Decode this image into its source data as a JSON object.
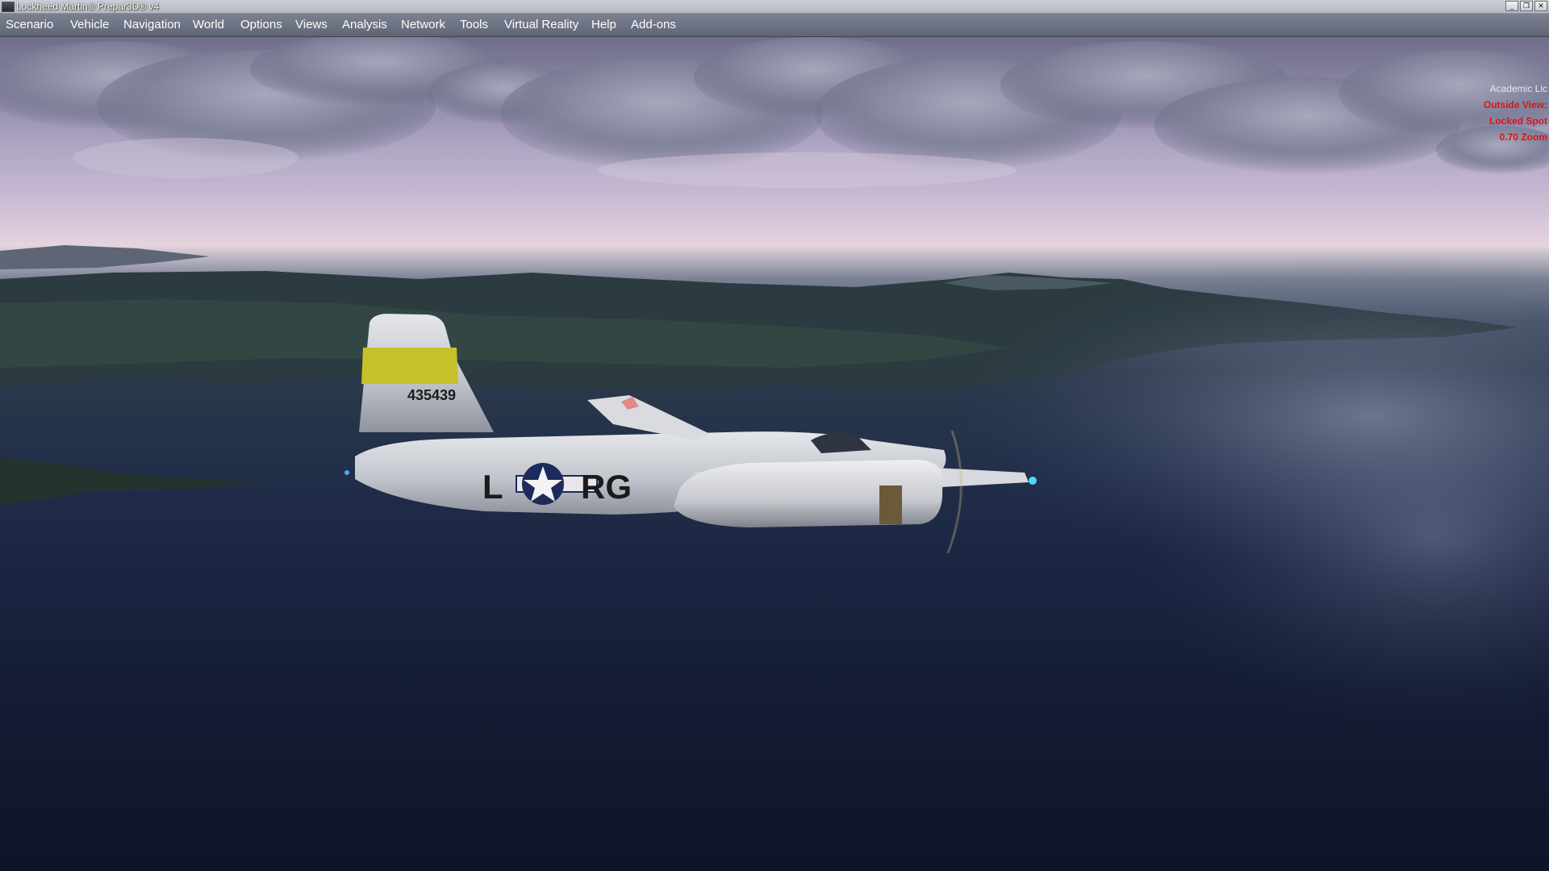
{
  "window": {
    "title": "Lockheed Martin® Prepar3D® v4",
    "controls": {
      "minimize": "_",
      "restore": "❐",
      "close": "✕"
    }
  },
  "menu": [
    {
      "label": "Scenario"
    },
    {
      "label": "Vehicle"
    },
    {
      "label": "Navigation"
    },
    {
      "label": "World"
    },
    {
      "label": "Options"
    },
    {
      "label": "Views"
    },
    {
      "label": "Analysis"
    },
    {
      "label": "Network"
    },
    {
      "label": "Tools"
    },
    {
      "label": "Virtual Reality"
    },
    {
      "label": "Help"
    },
    {
      "label": "Add-ons"
    }
  ],
  "hud": {
    "license": "Academic Lic",
    "view_mode": "Outside View:",
    "view_type": "Locked Spot",
    "zoom": "0.70 Zoom"
  },
  "aircraft": {
    "tail_number": "435439",
    "code_left": "L",
    "code_right": "RG",
    "colors": {
      "fuselage": "#c9ccd3",
      "tail_band": "#c6c12a",
      "roundel": "#1d2a5c"
    }
  },
  "scene_colors": {
    "sky_top": "#6f6d8a",
    "horizon": "#e6d4dd",
    "land": "#2a3b3e",
    "water": "#1c2643"
  }
}
